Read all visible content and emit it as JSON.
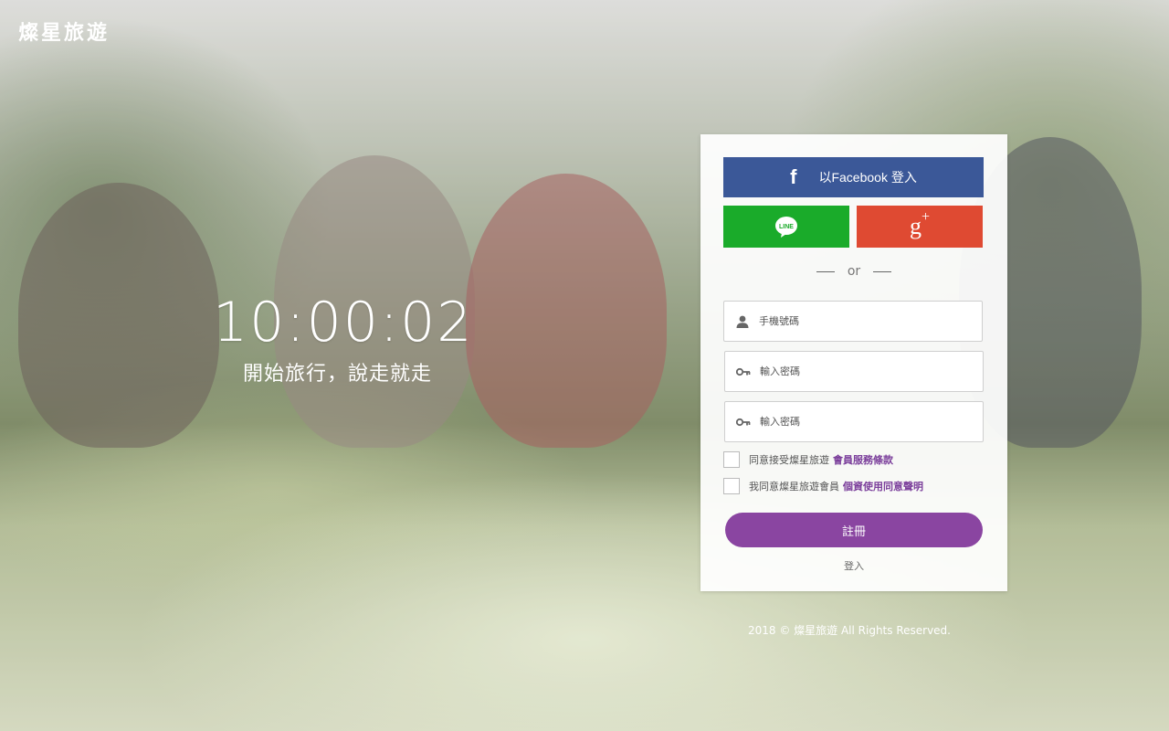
{
  "brand": {
    "logo_text": "燦星旅遊"
  },
  "hero": {
    "clock": "10:00:02",
    "tagline": "開始旅行，說走就走"
  },
  "social": {
    "facebook_label": "以Facebook 登入",
    "facebook_icon": "facebook-icon",
    "line_icon": "line-icon",
    "line_badge_text": "LINE",
    "google_icon": "google-plus-icon",
    "facebook_color": "#3b5898",
    "line_color": "#1aab2a",
    "google_color": "#df4a32"
  },
  "divider": {
    "or_text": "or"
  },
  "form": {
    "phone_placeholder": "手機號碼",
    "password_placeholder": "輸入密碼",
    "password_confirm_placeholder": "輸入密碼",
    "phone_icon": "user-icon",
    "password_icon": "key-icon"
  },
  "agreements": {
    "terms_prefix": "同意接受燦星旅遊",
    "terms_link": "會員服務條款",
    "privacy_prefix": "我同意燦星旅遊會員",
    "privacy_link": "個資使用同意聲明"
  },
  "actions": {
    "register_label": "註冊",
    "login_label": "登入",
    "register_color": "#8a45a1"
  },
  "footer": {
    "copyright": "2018 © 燦星旅遊 All Rights Reserved."
  }
}
